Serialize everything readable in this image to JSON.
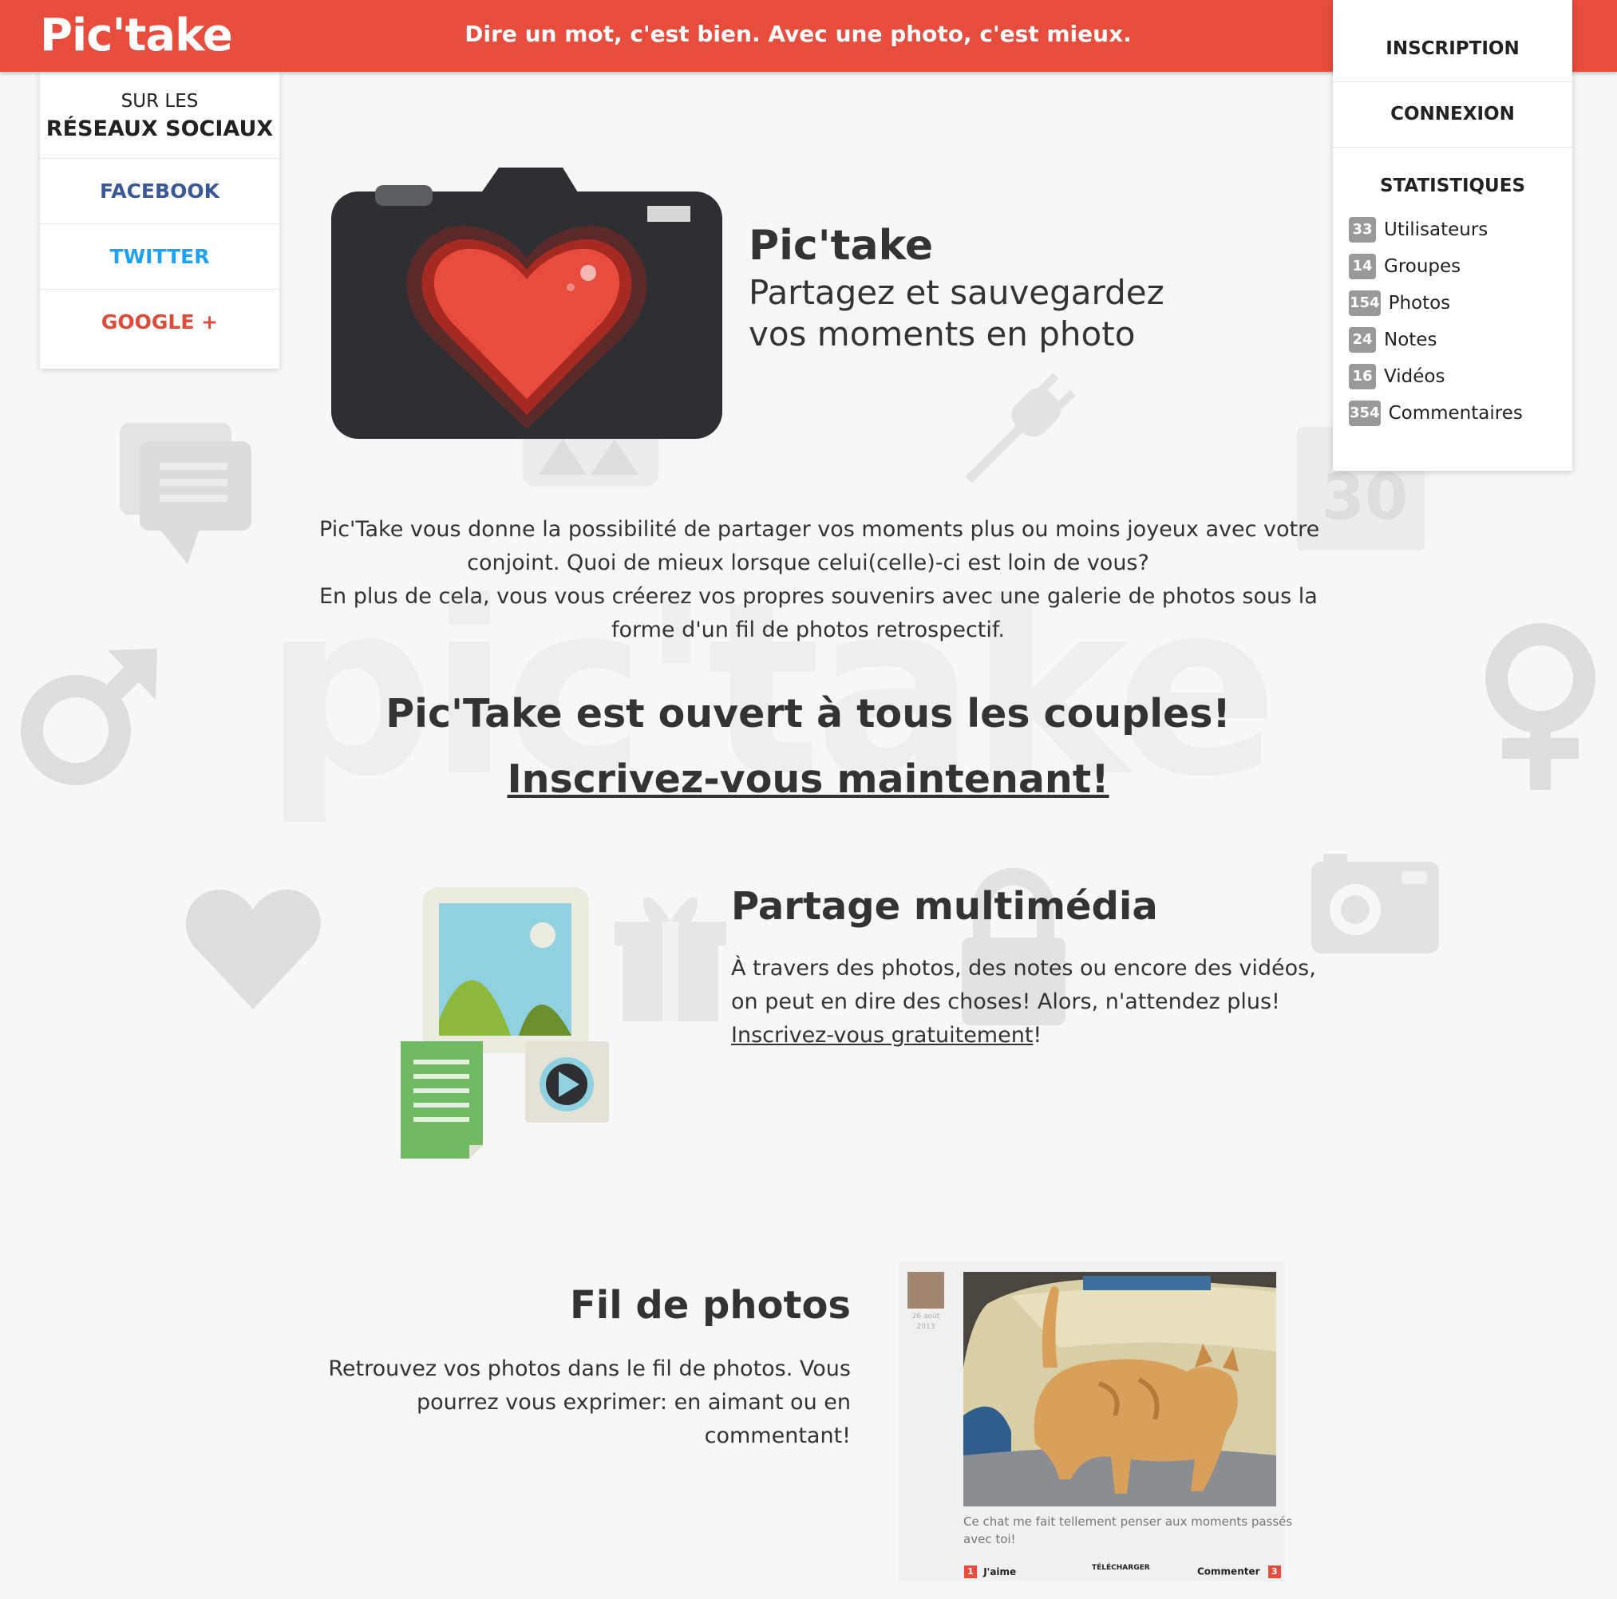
{
  "header": {
    "logo": "Pic'take",
    "tagline": "Dire un mot, c'est bien. Avec une photo, c'est mieux."
  },
  "account": {
    "inscription": "INSCRIPTION",
    "connexion": "CONNEXION"
  },
  "stats": {
    "title": "STATISTIQUES",
    "items": [
      {
        "count": "33",
        "label": "Utilisateurs"
      },
      {
        "count": "14",
        "label": "Groupes"
      },
      {
        "count": "154",
        "label": "Photos"
      },
      {
        "count": "24",
        "label": "Notes"
      },
      {
        "count": "16",
        "label": "Vidéos"
      },
      {
        "count": "354",
        "label": "Commentaires"
      }
    ]
  },
  "social": {
    "heading_line1": "SUR LES",
    "heading_line2": "RÉSEAUX SOCIAUX",
    "links": [
      {
        "label": "FACEBOOK",
        "color": "#3b5998"
      },
      {
        "label": "TWITTER",
        "color": "#1da1f2"
      },
      {
        "label": "GOOGLE +",
        "color": "#dd4b39"
      }
    ]
  },
  "hero": {
    "title": "Pic'take",
    "subtitle_line1": "Partagez et sauvegardez",
    "subtitle_line2": "vos moments en photo"
  },
  "intro": {
    "line1": "Pic'Take vous donne la possibilité de partager vos moments plus ou moins joyeux avec votre",
    "line2": "conjoint. Quoi de mieux lorsque celui(celle)-ci est loin de vous?",
    "line3": "En plus de cela, vous vous créerez vos propres souvenirs avec une galerie de photos sous la",
    "line4": "forme d'un fil de photos retrospectif."
  },
  "cta": {
    "couples": "Pic'Take est ouvert à tous les couples!",
    "signup_now": "Inscrivez-vous maintenant!"
  },
  "multimedia": {
    "title": "Partage multimédia",
    "line1": "À travers des photos, des notes ou encore des vidéos,",
    "line2": "on peut en dire des choses! Alors, n'attendez plus!",
    "link": "Inscrivez-vous gratuitement",
    "link_suffix": "!"
  },
  "feed": {
    "title": "Fil de photos",
    "line1": "Retrouvez vos photos dans le fil de photos. Vous",
    "line2": "pourrez vous exprimer: en aimant ou en",
    "line3": "commentant!",
    "card": {
      "date_line1": "26 août",
      "date_line2": "2013",
      "caption_line1": "Ce chat me fait tellement penser aux moments passés",
      "caption_line2": "avec toi!",
      "likes": "1",
      "like_label": "J'aime",
      "download_label": "TÉLÉCHARGER",
      "comment_label": "Commenter",
      "comments": "3"
    }
  },
  "watermark": "pic'take",
  "calendar_day": "30",
  "colors": {
    "brand": "#e74c3c",
    "badge": "#999999",
    "background": "#f7f7f7"
  }
}
